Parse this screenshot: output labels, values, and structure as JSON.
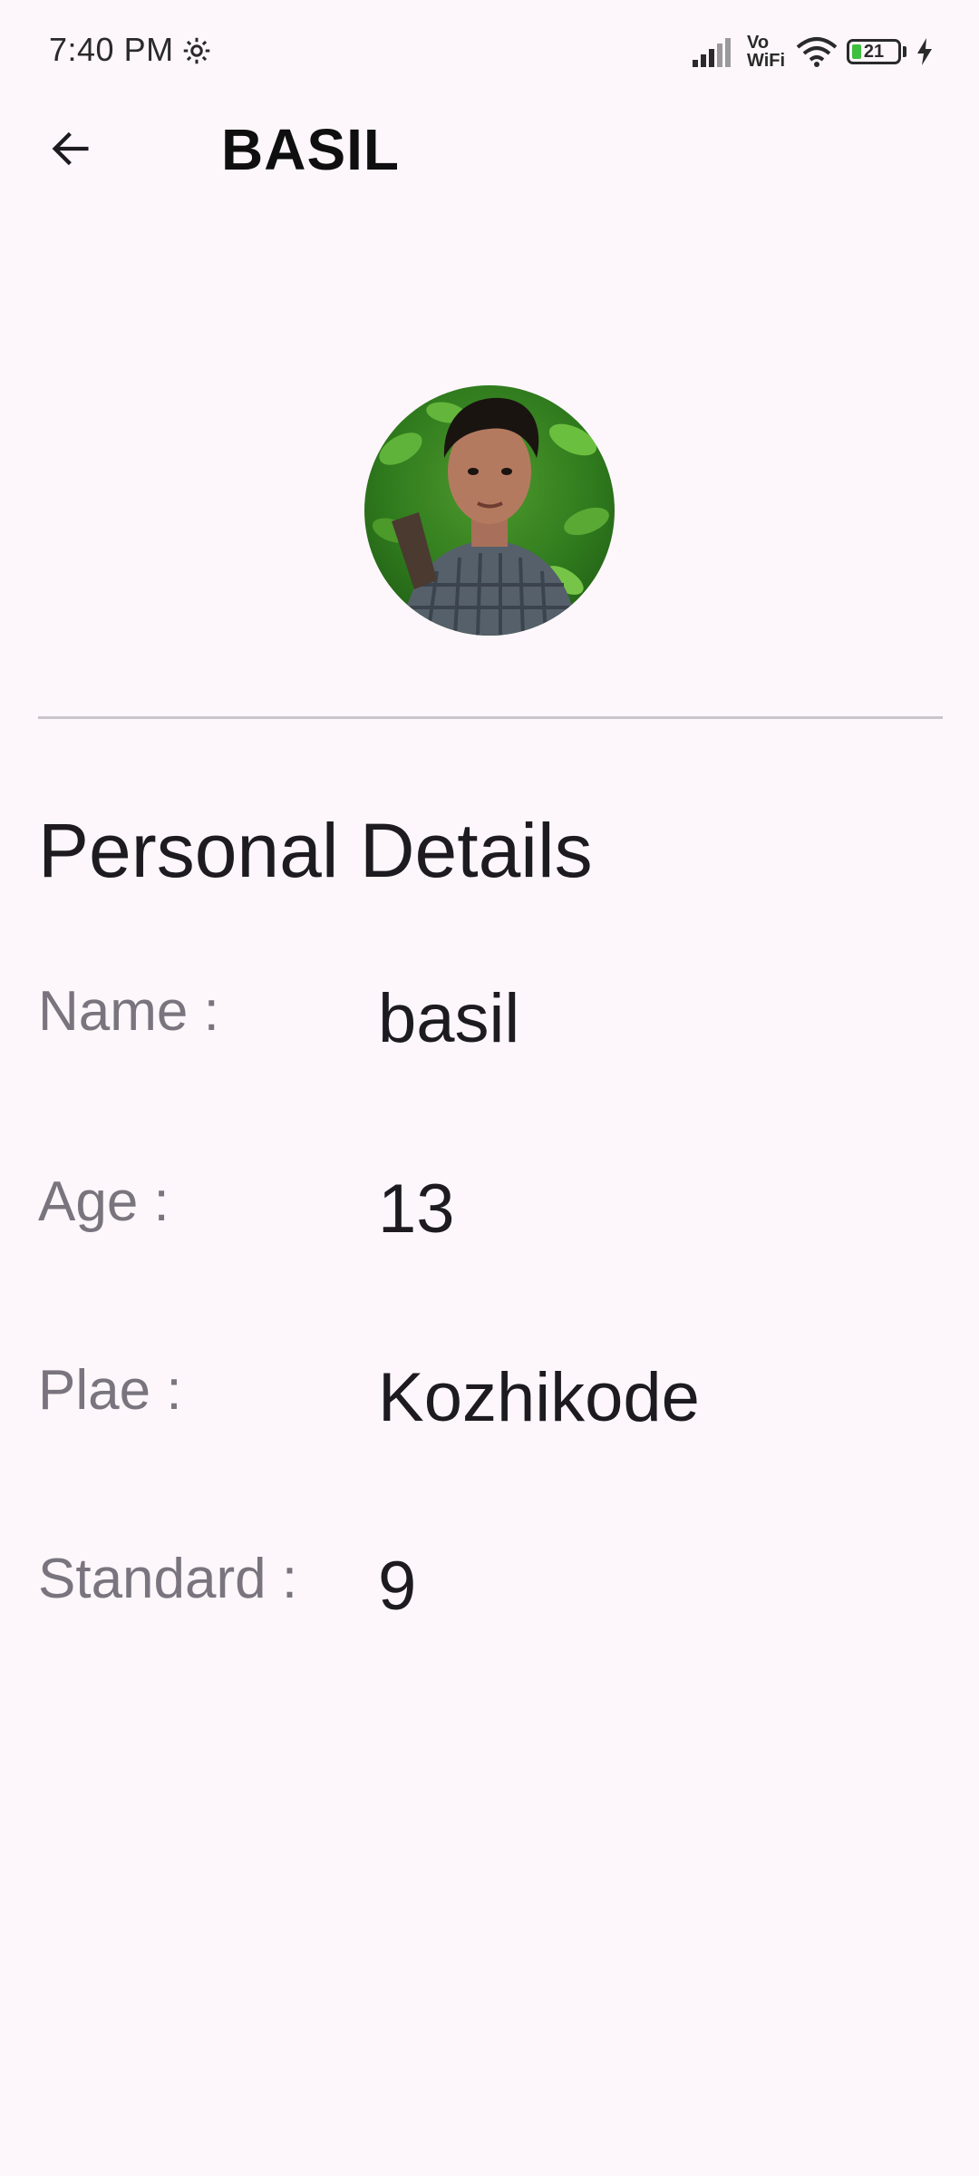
{
  "status_bar": {
    "time": "7:40 PM",
    "network": "Vo WiFi",
    "battery_level": "21",
    "icons": [
      "gear-icon",
      "signal-icon",
      "wifi-icon",
      "battery-icon",
      "charging-bolt-icon"
    ]
  },
  "app_bar": {
    "back_icon": "arrow-left-icon",
    "title": "BASIL"
  },
  "profile": {
    "avatar": "profile-photo"
  },
  "details": {
    "section_title": "Personal Details",
    "rows": [
      {
        "label": "Name :",
        "value": "basil"
      },
      {
        "label": "Age :",
        "value": "13"
      },
      {
        "label": "Plae :",
        "value": "Kozhikode"
      },
      {
        "label": "Standard :",
        "value": "9"
      }
    ]
  },
  "colors": {
    "background": "#fdf7fb",
    "label": "#79747e",
    "value": "#1d1b20",
    "divider": "#c9c5ca"
  }
}
